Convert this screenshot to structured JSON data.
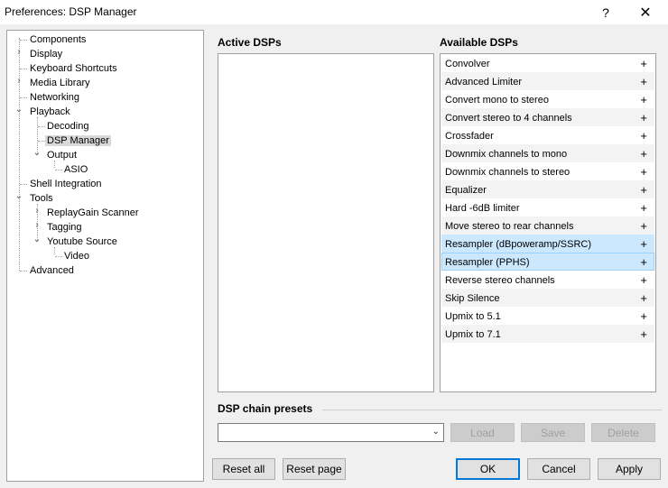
{
  "window": {
    "title": "Preferences: DSP Manager",
    "help_label": "?",
    "close_label": "✕"
  },
  "tree": {
    "items": [
      {
        "label": "Components"
      },
      {
        "label": "Display"
      },
      {
        "label": "Keyboard Shortcuts"
      },
      {
        "label": "Media Library"
      },
      {
        "label": "Networking"
      },
      {
        "label": "Playback"
      },
      {
        "label": "Decoding"
      },
      {
        "label": "DSP Manager"
      },
      {
        "label": "Output"
      },
      {
        "label": "ASIO"
      },
      {
        "label": "Shell Integration"
      },
      {
        "label": "Tools"
      },
      {
        "label": "ReplayGain Scanner"
      },
      {
        "label": "Tagging"
      },
      {
        "label": "Youtube Source"
      },
      {
        "label": "Video"
      },
      {
        "label": "Advanced"
      }
    ]
  },
  "active_dsps": {
    "title": "Active DSPs"
  },
  "available_dsps": {
    "title": "Available DSPs",
    "add_glyph": "+",
    "items": [
      {
        "label": "Convolver"
      },
      {
        "label": "Advanced Limiter"
      },
      {
        "label": "Convert mono to stereo"
      },
      {
        "label": "Convert stereo to 4 channels"
      },
      {
        "label": "Crossfader"
      },
      {
        "label": "Downmix channels to mono"
      },
      {
        "label": "Downmix channels to stereo"
      },
      {
        "label": "Equalizer"
      },
      {
        "label": "Hard -6dB limiter"
      },
      {
        "label": "Move stereo to rear channels"
      },
      {
        "label": "Resampler (dBpoweramp/SSRC)"
      },
      {
        "label": "Resampler (PPHS)"
      },
      {
        "label": "Reverse stereo channels"
      },
      {
        "label": "Skip Silence"
      },
      {
        "label": "Upmix to 5.1"
      },
      {
        "label": "Upmix to 7.1"
      }
    ]
  },
  "presets": {
    "title": "DSP chain presets",
    "selected": "",
    "load_label": "Load",
    "save_label": "Save",
    "delete_label": "Delete"
  },
  "footer": {
    "reset_all_label": "Reset all",
    "reset_page_label": "Reset page",
    "ok_label": "OK",
    "cancel_label": "Cancel",
    "apply_label": "Apply"
  },
  "colors": {
    "selection_hover": "#cce8ff",
    "selection_border": "#99d1ff",
    "default_button_border": "#0078d7"
  }
}
